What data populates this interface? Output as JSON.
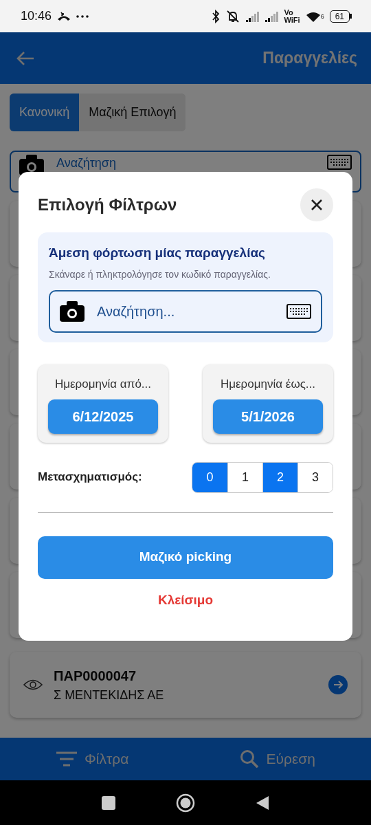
{
  "status_bar": {
    "time": "10:46",
    "vo": "Vo",
    "wifi": "WiFi",
    "wifi_band": "6",
    "battery": "61"
  },
  "app_bar": {
    "title": "Παραγγελίες"
  },
  "mode_tabs": [
    {
      "label": "Κανονική",
      "selected": true
    },
    {
      "label": "Μαζική Επιλογή",
      "selected": false
    }
  ],
  "search": {
    "placeholder": "Αναζήτηση"
  },
  "orders": [
    {
      "code": "ΠΑΡ0000047",
      "customer": "Σ ΜΕΝΤΕΚΙΔΗΣ ΑΕ"
    }
  ],
  "bottom_bar": [
    {
      "kind": "filter",
      "label": "Φίλτρα"
    },
    {
      "kind": "search",
      "label": "Εύρεση"
    }
  ],
  "dialog": {
    "title": "Επιλογή Φίλτρων",
    "quick_load": {
      "title": "Άμεση φόρτωση μίας παραγγελίας",
      "hint": "Σκάναρε ή πληκτρολόγησε τον κωδικό παραγγελίας.",
      "placeholder": "Αναζήτηση..."
    },
    "dates": [
      {
        "label": "Ημερομηνία από...",
        "value": "6/12/2025"
      },
      {
        "label": "Ημερομηνία έως...",
        "value": "5/1/2026"
      }
    ],
    "transform": {
      "label": "Μετασχηματισμός:",
      "options": [
        {
          "label": "0",
          "selected": true
        },
        {
          "label": "1",
          "selected": false
        },
        {
          "label": "2",
          "selected": true
        },
        {
          "label": "3",
          "selected": false
        }
      ]
    },
    "primary_button": "Μαζικό picking",
    "close_button": "Κλείσιμο"
  }
}
